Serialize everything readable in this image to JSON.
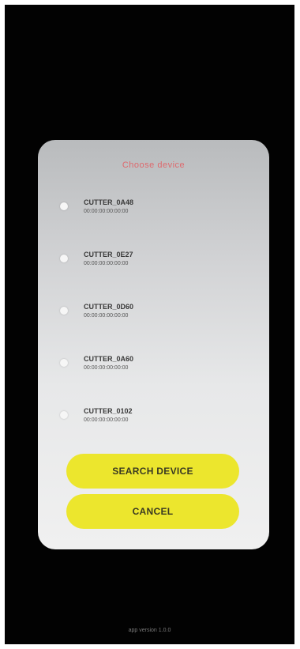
{
  "dialog": {
    "title": "Choose device",
    "devices": [
      {
        "name": "CUTTER_0A48",
        "address": "00:00:00:00:00:00",
        "selected": false
      },
      {
        "name": "CUTTER_0E27",
        "address": "00:00:00:00:00:00",
        "selected": false
      },
      {
        "name": "CUTTER_0D60",
        "address": "00:00:00:00:00:00",
        "selected": false
      },
      {
        "name": "CUTTER_0A60",
        "address": "00:00:00:00:00:00",
        "selected": false
      },
      {
        "name": "CUTTER_0102",
        "address": "00:00:00:00:00:00",
        "selected": false
      }
    ],
    "search_label": "SEARCH DEVICE",
    "cancel_label": "CANCEL"
  },
  "footer": {
    "text": "app version 1.0.0"
  },
  "colors": {
    "accent_button": "#ece62d",
    "title_color": "#e45a5f",
    "background": "#020202"
  }
}
